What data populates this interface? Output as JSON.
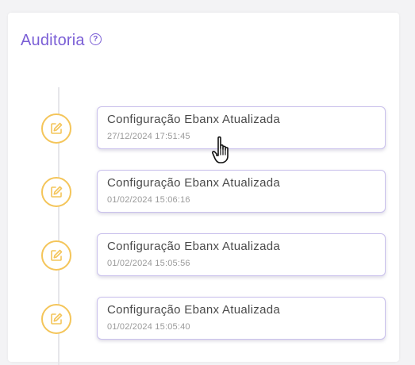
{
  "audit": {
    "title": "Auditoria",
    "help_icon": "?",
    "entries": [
      {
        "title": "Configuração Ebanx Atualizada",
        "timestamp": "27/12/2024 17:51:45",
        "icon": "edit-icon"
      },
      {
        "title": "Configuração Ebanx Atualizada",
        "timestamp": "01/02/2024 15:06:16",
        "icon": "edit-icon"
      },
      {
        "title": "Configuração Ebanx Atualizada",
        "timestamp": "01/02/2024 15:05:56",
        "icon": "edit-icon"
      },
      {
        "title": "Configuração Ebanx Atualizada",
        "timestamp": "01/02/2024 15:05:40",
        "icon": "edit-icon"
      }
    ]
  },
  "colors": {
    "accent": "#7b5fd6",
    "marker": "#f4c55a",
    "card_border": "#c9c0ec"
  }
}
